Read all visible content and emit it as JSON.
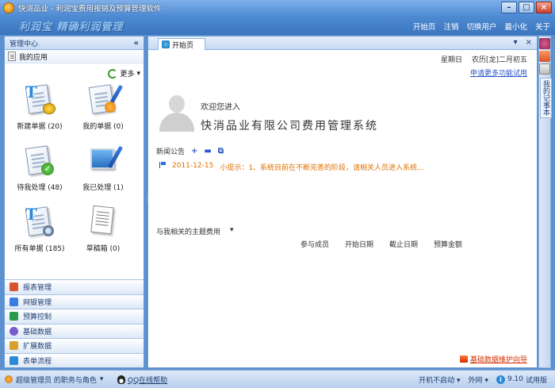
{
  "window": {
    "title": "快消品业 - 利润宝费用报销及预算管理软件",
    "controls": [
      "–",
      "□",
      "×"
    ]
  },
  "brand": {
    "slogan": "利润宝  精确利润管理"
  },
  "top_menu": [
    "开始页",
    "注销",
    "切换用户",
    "最小化",
    "关于"
  ],
  "left_panel": {
    "title": "管理中心",
    "collapse_glyph": "«",
    "my_apps": "我的应用",
    "more": "更多",
    "apps": [
      {
        "label": "新建单据 (20)"
      },
      {
        "label": "我的单据 (0)"
      },
      {
        "label": "待我处理 (48)"
      },
      {
        "label": "我已处理 (1)"
      },
      {
        "label": "所有单据 (185)"
      },
      {
        "label": "草稿箱 (0)"
      }
    ],
    "nav": [
      {
        "label": "报表管理",
        "color": "#d9532c"
      },
      {
        "label": "网银管理",
        "color": "#3a7de0"
      },
      {
        "label": "预算控制",
        "color": "#2a9a4a"
      },
      {
        "label": "基础数据",
        "color": "#7a5ad0"
      },
      {
        "label": "扩展数据",
        "color": "#d9a02c"
      },
      {
        "label": "表单流程",
        "color": "#2a8ad8"
      }
    ]
  },
  "main": {
    "tab_label": "开始页",
    "tab_controls": [
      "▾",
      "×"
    ],
    "weekday": "星期日",
    "lunar": "农历[龙]二月初五",
    "more_apps_link": "申请更多功能试用",
    "welcome": "欢迎您进入",
    "system_title": "快消品业有限公司费用管理系统",
    "news": {
      "title": "新闻公告",
      "controls": [
        "+",
        "▬",
        "⧉"
      ],
      "items": [
        {
          "date": "2011-12-15",
          "text": "小提示：1、系统目前在不断完善的阶段，请相关人员进入系统..."
        }
      ]
    },
    "subject": {
      "title": "与我相关的主题费用",
      "dropdown": "▾",
      "columns": [
        "参与成员",
        "开始日期",
        "截止日期",
        "预算金额"
      ]
    },
    "wizard_link": "基础数据维护向导"
  },
  "right_tools": {
    "notebook": "我的记事本"
  },
  "status_bar": {
    "role": "超级管理员 的职务与角色",
    "qq": "QQ在线帮助",
    "autostart": "开机不启动",
    "network": "外网",
    "version": "9.10",
    "edition": "试用版"
  }
}
